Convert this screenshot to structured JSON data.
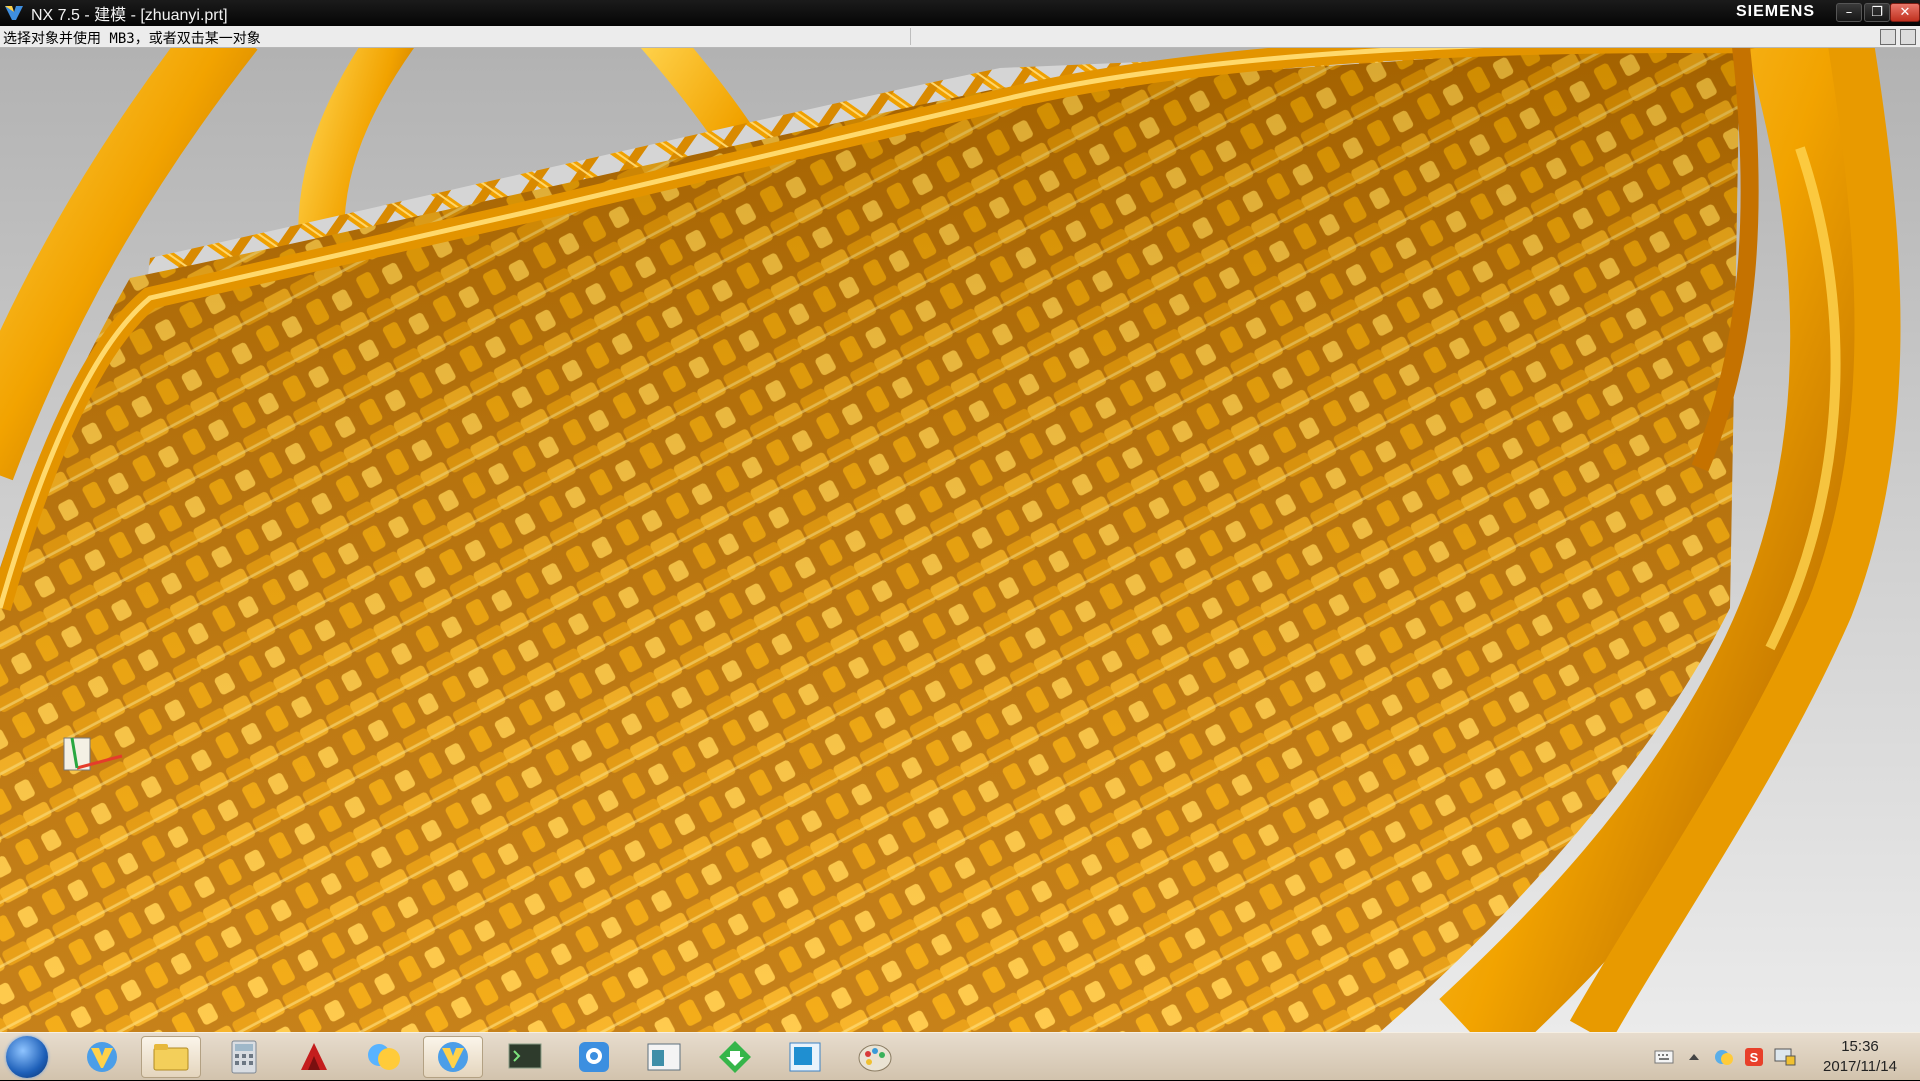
{
  "window": {
    "title": "NX 7.5 - 建模 - [zhuanyi.prt]",
    "brand": "SIEMENS",
    "minimize_glyph": "–",
    "restore_glyph": "❐",
    "close_glyph": "✕"
  },
  "cue_line": {
    "text": "选择对象并使用 MB3，或者双击某一对象"
  },
  "colors": {
    "model_gold": "#f2a300",
    "model_dark": "#b86a00",
    "model_light": "#ffd24a",
    "background_top": "#b2b2b2",
    "background_bottom": "#ebebeb"
  },
  "taskbar": {
    "items": [
      {
        "name": "nx-app-icon"
      },
      {
        "name": "explorer-icon"
      },
      {
        "name": "calculator-icon"
      },
      {
        "name": "autocad-icon"
      },
      {
        "name": "messenger-icon"
      },
      {
        "name": "nx-active-icon"
      },
      {
        "name": "terminal-icon"
      },
      {
        "name": "qq-icon"
      },
      {
        "name": "window-manager-icon"
      },
      {
        "name": "download-icon"
      },
      {
        "name": "desktop-icon"
      },
      {
        "name": "paint-icon"
      }
    ],
    "tray_icons": [
      "keyboard-icon",
      "show-hidden-icon",
      "network-icon",
      "sogou-input-icon",
      "display-icon"
    ],
    "time": "15:36",
    "date": "2017/11/14"
  }
}
